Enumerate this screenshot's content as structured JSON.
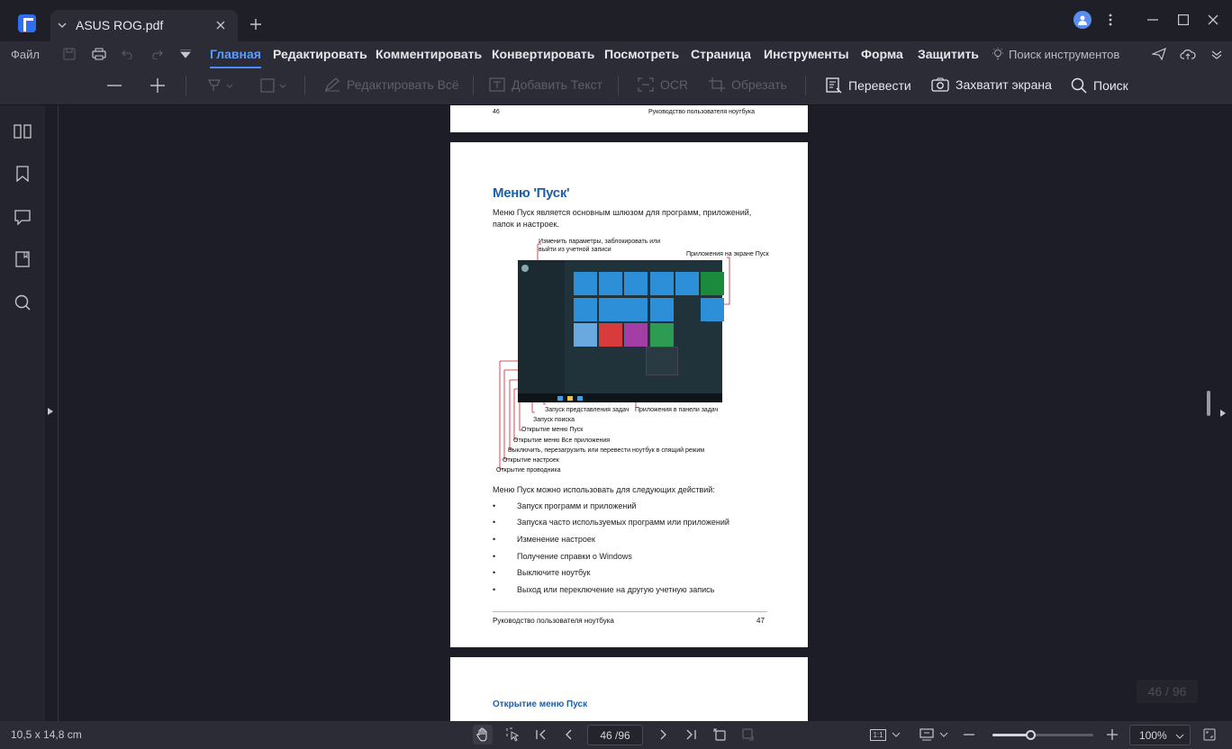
{
  "tab": {
    "title": "ASUS ROG.pdf"
  },
  "menu": {
    "file": "Файл",
    "items": [
      "Главная",
      "Редактировать",
      "Комментировать",
      "Конвертировать",
      "Посмотреть",
      "Страница",
      "Инструменты",
      "Форма",
      "Защитить"
    ],
    "active": "Главная",
    "search_tools": "Поиск инструментов"
  },
  "toolbar": {
    "edit_all": "Редактировать Всё",
    "add_text": "Добавить Текст",
    "ocr": "OCR",
    "crop": "Обрезать",
    "translate": "Перевести",
    "screenshot": "Захватит экрана",
    "search": "Поиск"
  },
  "document": {
    "prev_footer_left": "46",
    "prev_footer_right": "Руководство пользователя ноутбука",
    "title": "Меню 'Пуск'",
    "intro": "Меню Пуск является основным шлюзом для программ, приложений, папок и настроек.",
    "callouts": {
      "account": "Изменить параметры, заблокировать или выйти из учетной записи",
      "start_apps": "Приложения на экране Пуск",
      "task_view": "Запуск представления задач",
      "taskbar_apps": "Приложения в панели задач",
      "search": "Запуск поиска",
      "open_start": "Открытие меню Пуск",
      "all_apps": "Открытие меню Все приложения",
      "power": "Выключить, перезагрузить или перевести ноутбук в спящий режим",
      "settings": "Открытие настроек",
      "explorer": "Открытие проводника"
    },
    "list_intro": "Меню Пуск можно использовать для следующих действий:",
    "bullets": [
      "Запуск программ и приложений",
      "Запуска часто используемых программ или приложений",
      "Изменение настроек",
      "Получение справки о Windows",
      "Выключите ноутбук",
      "Выход или переключение на другую учетную запись"
    ],
    "footer_left": "Руководство пользователя ноутбука",
    "footer_right": "47",
    "next_heading": "Открытие меню Пуск"
  },
  "status": {
    "page_size": "10,5 x 14,8 cm",
    "page_input": "46 /96",
    "page_badge": "46 / 96",
    "zoom": "100%",
    "fit_label": "1:1"
  },
  "colors": {
    "accent": "#4a8cff",
    "heading": "#1d5fa8",
    "callout_line": "#cc1f2a"
  }
}
